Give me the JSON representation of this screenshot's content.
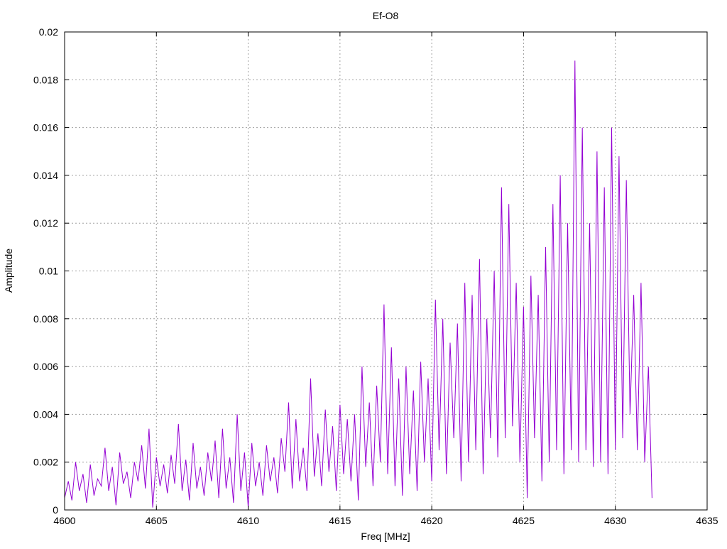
{
  "chart_data": {
    "type": "line",
    "title": "Ef-O8",
    "xlabel": "Freq [MHz]",
    "ylabel": "Amplitude",
    "xlim": [
      4600,
      4635
    ],
    "ylim": [
      0,
      0.02
    ],
    "xticks": [
      "4600",
      "4605",
      "4610",
      "4615",
      "4620",
      "4625",
      "4630",
      "4635"
    ],
    "yticks": [
      "0",
      "0.002",
      "0.004",
      "0.006",
      "0.008",
      "0.01",
      "0.012",
      "0.014",
      "0.016",
      "0.018",
      "0.02"
    ],
    "grid": true,
    "legend": "none",
    "series": [
      {
        "name": "Ef-O8",
        "color": "#9400d3",
        "x_start": 4600,
        "x_step": 0.2,
        "values": [
          0.0005,
          0.0012,
          0.0004,
          0.002,
          0.0008,
          0.0015,
          0.0003,
          0.0019,
          0.0006,
          0.0013,
          0.001,
          0.0026,
          0.0008,
          0.0018,
          0.0002,
          0.0024,
          0.0011,
          0.0016,
          0.0005,
          0.002,
          0.0012,
          0.0027,
          0.0009,
          0.0034,
          0.0001,
          0.0022,
          0.001,
          0.0019,
          0.0007,
          0.0023,
          0.0011,
          0.0036,
          0.0008,
          0.0021,
          0.0004,
          0.0028,
          0.0009,
          0.0018,
          0.0006,
          0.0024,
          0.0012,
          0.0029,
          0.0005,
          0.0034,
          0.0009,
          0.0022,
          0.0003,
          0.004,
          0.0008,
          0.0024,
          0.0001,
          0.0028,
          0.001,
          0.002,
          0.0006,
          0.0027,
          0.0012,
          0.0022,
          0.0007,
          0.003,
          0.0016,
          0.0045,
          0.0009,
          0.0038,
          0.0012,
          0.0026,
          0.0008,
          0.0055,
          0.0014,
          0.0032,
          0.001,
          0.0042,
          0.0016,
          0.0035,
          0.0008,
          0.0044,
          0.0015,
          0.0038,
          0.0012,
          0.004,
          0.0004,
          0.006,
          0.0018,
          0.0045,
          0.001,
          0.0052,
          0.002,
          0.0086,
          0.0015,
          0.0068,
          0.001,
          0.0055,
          0.0006,
          0.006,
          0.0015,
          0.005,
          0.0008,
          0.0062,
          0.002,
          0.0055,
          0.0012,
          0.0088,
          0.0025,
          0.008,
          0.0015,
          0.007,
          0.003,
          0.0078,
          0.0012,
          0.0095,
          0.002,
          0.009,
          0.0025,
          0.0105,
          0.0015,
          0.008,
          0.003,
          0.01,
          0.0022,
          0.0135,
          0.003,
          0.0128,
          0.0035,
          0.0095,
          0.002,
          0.0085,
          0.0005,
          0.0098,
          0.003,
          0.009,
          0.0012,
          0.011,
          0.002,
          0.0128,
          0.0025,
          0.014,
          0.0015,
          0.012,
          0.0025,
          0.0188,
          0.002,
          0.016,
          0.0025,
          0.012,
          0.0018,
          0.015,
          0.002,
          0.0135,
          0.0015,
          0.016,
          0.0025,
          0.0148,
          0.003,
          0.0138,
          0.004,
          0.009,
          0.0025,
          0.0095,
          0.002,
          0.006,
          0.0005
        ]
      }
    ]
  }
}
